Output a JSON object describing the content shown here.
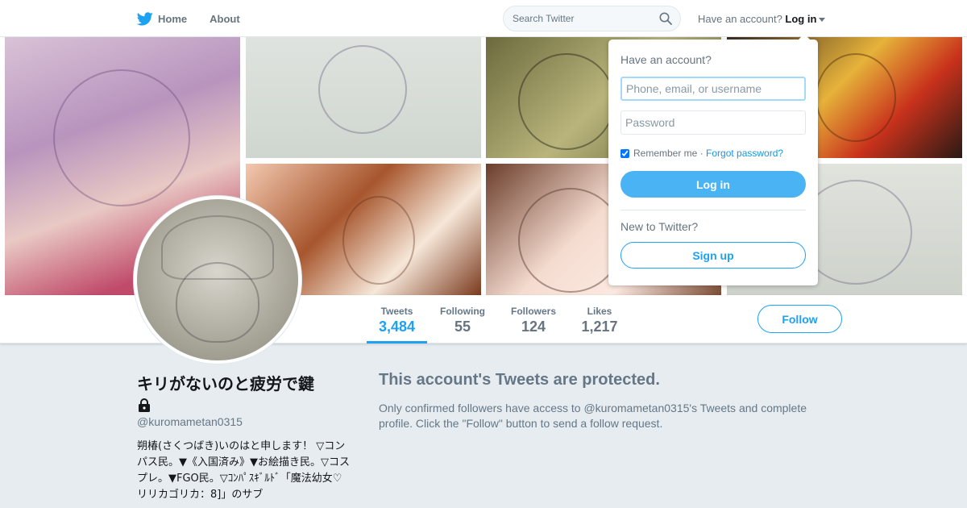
{
  "nav": {
    "home_label": "Home",
    "about_label": "About",
    "search_placeholder": "Search Twitter",
    "have_account": "Have an account?",
    "login_label": "Log in"
  },
  "profile": {
    "name": "キリがないのと疲労で鍵",
    "handle": "@kuromametan0315",
    "bio": "朔椿(さくつばき)いのはと申します！ ▽コンパス民。▼《入国済み》▼お絵描き民。▽コスプレ。▼FGO民。▽ｺﾝﾊﾟｽｷﾞﾙﾄﾞ「魔法幼女♡リリカゴリカ：8]」のサブ",
    "follow_label": "Follow"
  },
  "stats": [
    {
      "label": "Tweets",
      "value": "3,484"
    },
    {
      "label": "Following",
      "value": "55"
    },
    {
      "label": "Followers",
      "value": "124"
    },
    {
      "label": "Likes",
      "value": "1,217"
    }
  ],
  "protected": {
    "title": "This account's Tweets are protected.",
    "body": "Only confirmed followers have access to @kuromametan0315's Tweets and complete profile. Click the \"Follow\" button to send a follow request."
  },
  "login_dropdown": {
    "heading": "Have an account?",
    "username_placeholder": "Phone, email, or username",
    "password_placeholder": "Password",
    "remember_label": "Remember me",
    "separator": " · ",
    "forgot_label": "Forgot password?",
    "login_button": "Log in",
    "new_to_twitter": "New to Twitter?",
    "signup_button": "Sign up"
  },
  "colors": {
    "brand": "#1da1f2",
    "login_button_bg": "#4ab3f4",
    "page_bg": "#e6ecf0"
  },
  "icons": [
    "twitter-bird-icon",
    "search-icon",
    "caret-down-icon",
    "lock-icon"
  ]
}
